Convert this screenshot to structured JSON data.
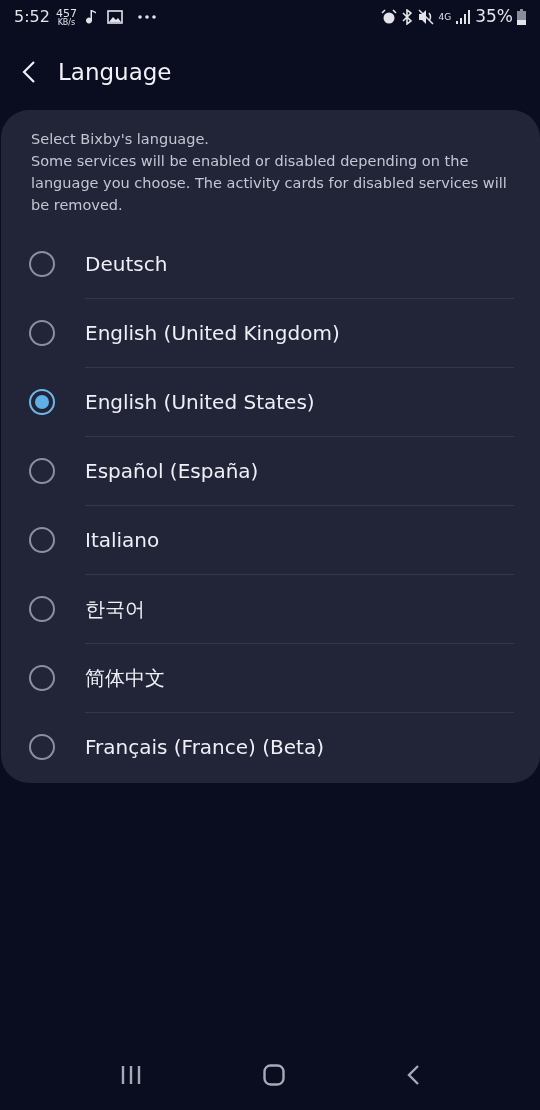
{
  "status_bar": {
    "time": "5:52",
    "speed": "457",
    "speed_unit": "KB/s",
    "network": "4G",
    "battery": "35%"
  },
  "header": {
    "title": "Language"
  },
  "description": [
    "Select Bixby's language.",
    "Some services will be enabled or disabled depending on the language you choose. The activity cards for disabled services will be removed."
  ],
  "languages": [
    {
      "label": "Deutsch",
      "selected": false
    },
    {
      "label": "English (United Kingdom)",
      "selected": false
    },
    {
      "label": "English (United States)",
      "selected": true
    },
    {
      "label": "Español (España)",
      "selected": false
    },
    {
      "label": "Italiano",
      "selected": false
    },
    {
      "label": "한국어",
      "selected": false
    },
    {
      "label": "简体中文",
      "selected": false
    },
    {
      "label": "Français (France) (Beta)",
      "selected": false
    }
  ]
}
